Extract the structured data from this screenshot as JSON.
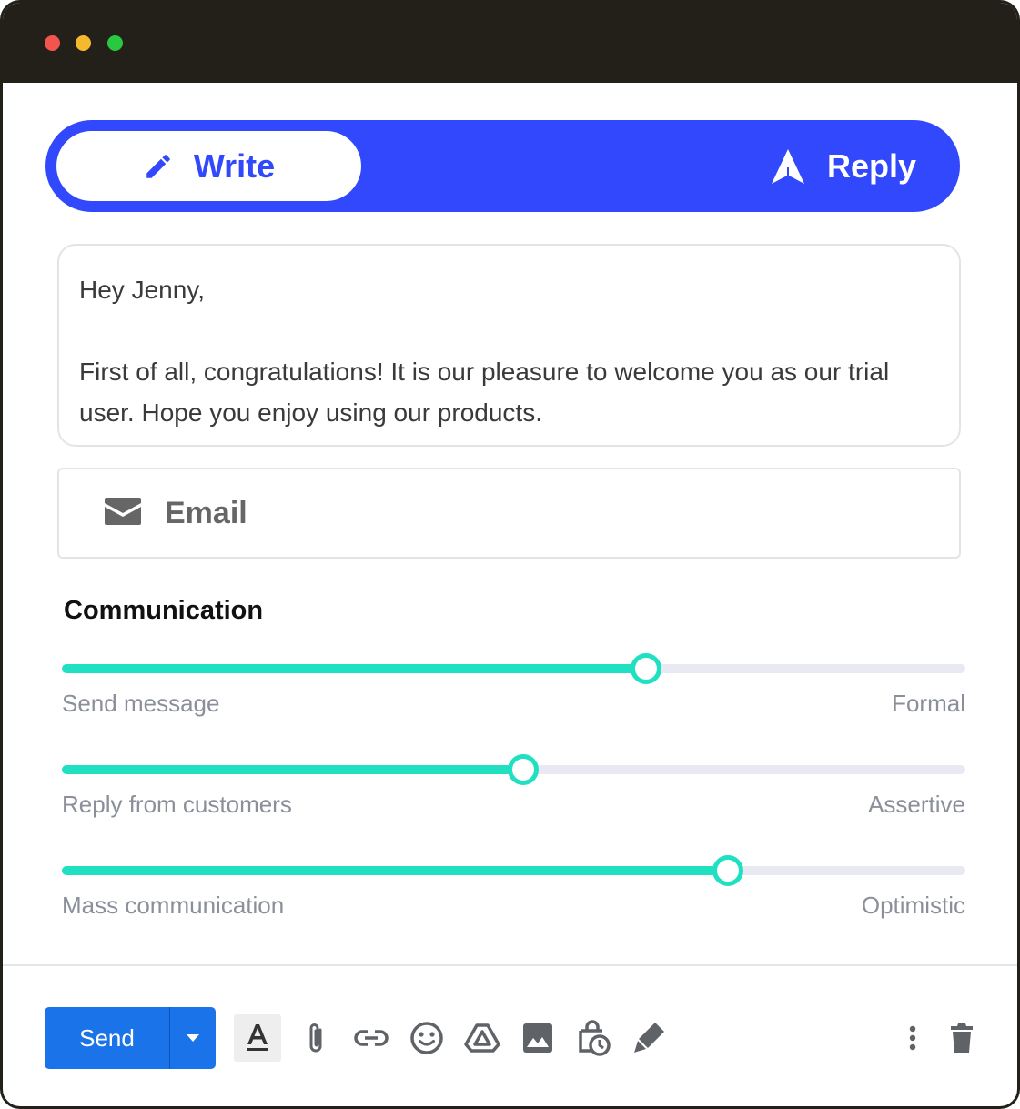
{
  "mode_toggle": {
    "write_label": "Write",
    "reply_label": "Reply",
    "active": "Write"
  },
  "message": {
    "greeting": "Hey Jenny,",
    "body": "First of all, congratulations! It is our pleasure to welcome you as our trial user. Hope you enjoy using our products."
  },
  "channel": {
    "label": "Email",
    "icon": "envelope-icon"
  },
  "communication": {
    "title": "Communication",
    "sliders": [
      {
        "left_label": "Send message",
        "right_label": "Formal",
        "value": 0.647
      },
      {
        "left_label": "Reply from customers",
        "right_label": "Assertive",
        "value": 0.511
      },
      {
        "left_label": "Mass communication",
        "right_label": "Optimistic",
        "value": 0.737
      }
    ]
  },
  "toolbar": {
    "send_label": "Send",
    "icons": [
      "send-options-icon",
      "text-format-icon",
      "attach-icon",
      "link-icon",
      "emoji-icon",
      "drive-icon",
      "photo-icon",
      "schedule-icon",
      "signature-icon",
      "more-icon",
      "trash-icon"
    ]
  },
  "colors": {
    "accent": "#3248fd",
    "slider": "#1fe0c0",
    "send_button": "#1a73e8",
    "titlebar": "#222019"
  }
}
